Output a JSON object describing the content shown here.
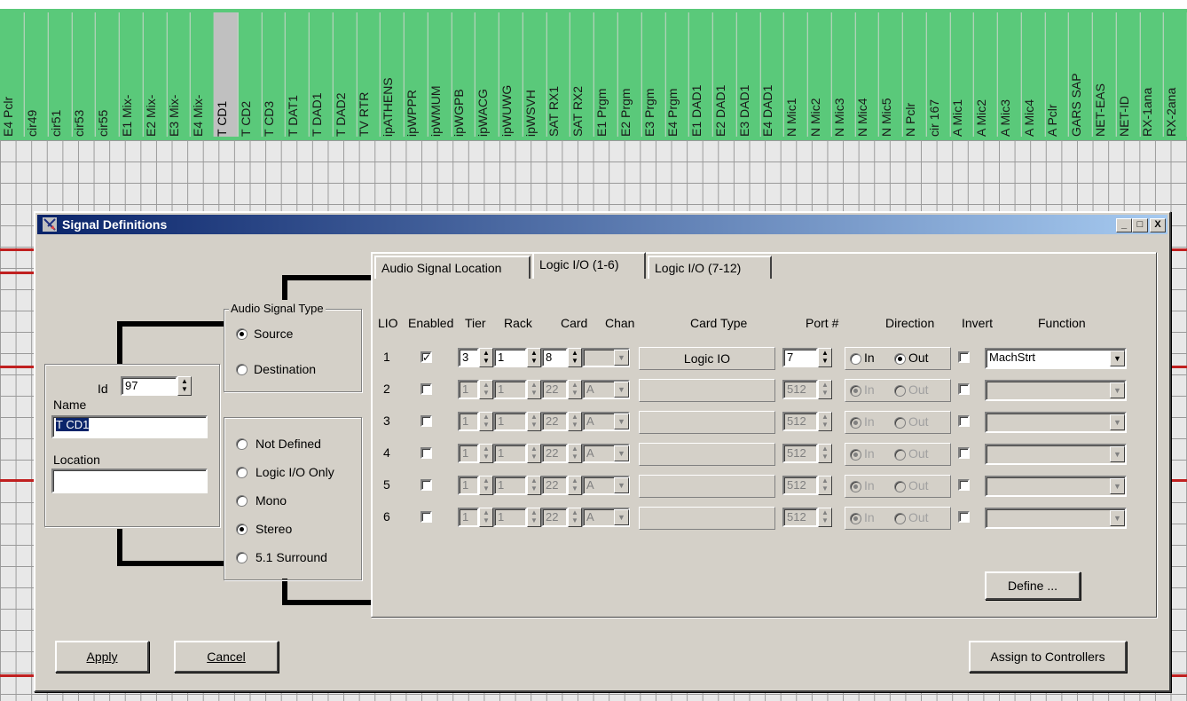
{
  "columns": [
    "E4 Pclr",
    "cir49",
    "cir51",
    "cir53",
    "cir55",
    "E1 Mix-",
    "E2 Mix-",
    "E3 Mix-",
    "E4 Mix-",
    "T CD1",
    "T CD2",
    "T CD3",
    "T DAT1",
    "T DAD1",
    "T DAD2",
    "TV RTR",
    "ipATHENS",
    "ipWPPR",
    "ipWMUM",
    "ipWGPB",
    "ipWACG",
    "ipWUWG",
    "ipWSVH",
    "SAT RX1",
    "SAT RX2",
    "E1 Prgm",
    "E2 Prgm",
    "E3 Prgm",
    "E4 Prgm",
    "E1 DAD1",
    "E2 DAD1",
    "E3 DAD1",
    "E4 DAD1",
    "N Mic1",
    "N Mic2",
    "N Mic3",
    "N Mic4",
    "N Mic5",
    "N Pclr",
    "cir 167",
    "A Mic1",
    "A Mic2",
    "A Mic3",
    "A Mic4",
    "A Pclr",
    "GARS SAP",
    "NET-EAS",
    "NET-ID",
    "RX-1ana",
    "RX-2ana"
  ],
  "window": {
    "title": "Signal Definitions",
    "min": "_",
    "max": "□",
    "close": "X"
  },
  "signal": {
    "id_label": "Id",
    "id_value": "97",
    "name_label": "Name",
    "name_value": "T CD1",
    "location_label": "Location",
    "location_value": ""
  },
  "signal_type": {
    "legend": "Audio Signal Type",
    "source": "Source",
    "destination": "Destination",
    "selected": "source"
  },
  "format": {
    "options": [
      "Not Defined",
      "Logic I/O Only",
      "Mono",
      "Stereo",
      "5.1 Surround"
    ],
    "selected": "Stereo"
  },
  "tabs": [
    "Audio Signal Location",
    "Logic I/O (1-6)",
    "Logic I/O (7-12)"
  ],
  "active_tab": "Logic I/O (1-6)",
  "headers": {
    "lio": "LIO",
    "enabled": "Enabled",
    "tier": "Tier",
    "rack": "Rack",
    "card": "Card",
    "chan": "Chan",
    "card_type": "Card Type",
    "port": "Port #",
    "direction": "Direction",
    "invert": "Invert",
    "function": "Function"
  },
  "dir_in": "In",
  "dir_out": "Out",
  "rows": [
    {
      "lio": "1",
      "enabled": true,
      "tier": "3",
      "rack": "1",
      "card": "8",
      "chan": "",
      "card_type": "Logic IO",
      "port": "7",
      "direction": "Out",
      "invert": false,
      "function": "MachStrt"
    },
    {
      "lio": "2",
      "enabled": false,
      "tier": "1",
      "rack": "1",
      "card": "22",
      "chan": "A",
      "card_type": "",
      "port": "512",
      "direction": "In",
      "invert": false,
      "function": ""
    },
    {
      "lio": "3",
      "enabled": false,
      "tier": "1",
      "rack": "1",
      "card": "22",
      "chan": "A",
      "card_type": "",
      "port": "512",
      "direction": "In",
      "invert": false,
      "function": ""
    },
    {
      "lio": "4",
      "enabled": false,
      "tier": "1",
      "rack": "1",
      "card": "22",
      "chan": "A",
      "card_type": "",
      "port": "512",
      "direction": "In",
      "invert": false,
      "function": ""
    },
    {
      "lio": "5",
      "enabled": false,
      "tier": "1",
      "rack": "1",
      "card": "22",
      "chan": "A",
      "card_type": "",
      "port": "512",
      "direction": "In",
      "invert": false,
      "function": ""
    },
    {
      "lio": "6",
      "enabled": false,
      "tier": "1",
      "rack": "1",
      "card": "22",
      "chan": "A",
      "card_type": "",
      "port": "512",
      "direction": "In",
      "invert": false,
      "function": ""
    }
  ],
  "buttons": {
    "define": "Define ...",
    "apply": "Apply",
    "cancel": "Cancel",
    "assign": "Assign to Controllers"
  }
}
